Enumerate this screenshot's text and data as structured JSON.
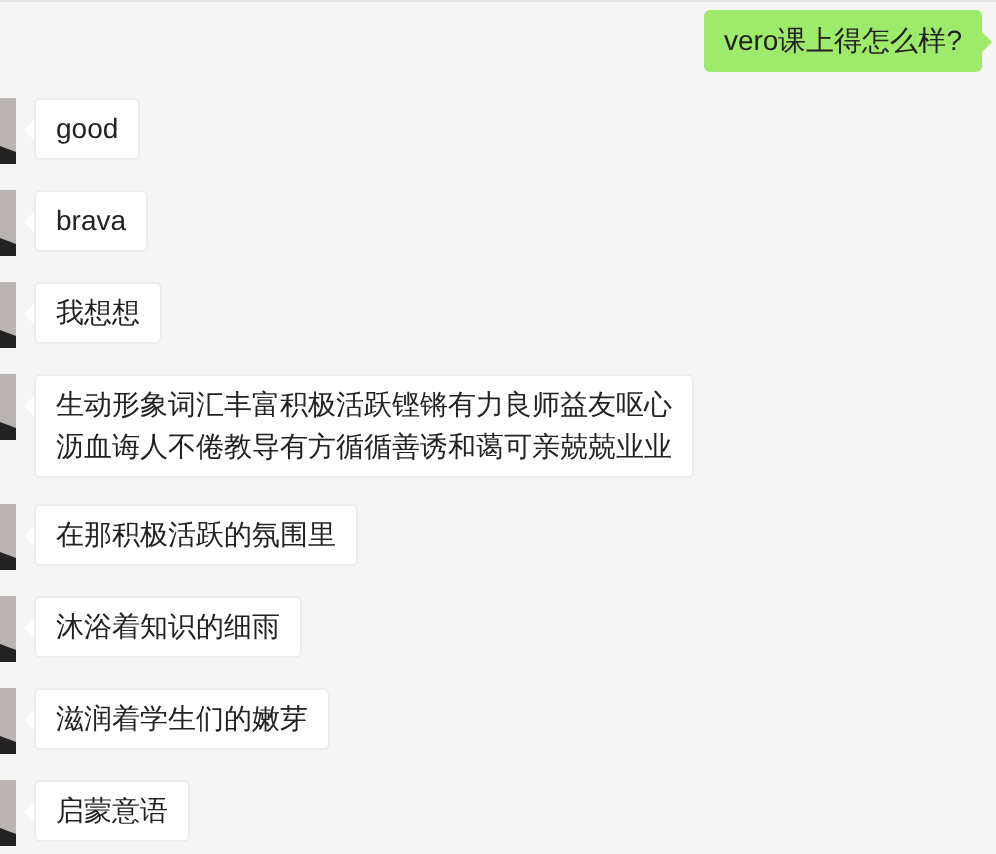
{
  "messages": [
    {
      "kind": "outgoing",
      "text": "vero课上得怎么样?"
    },
    {
      "kind": "incoming",
      "text": "good"
    },
    {
      "kind": "incoming",
      "text": "brava"
    },
    {
      "kind": "incoming",
      "text": "我想想"
    },
    {
      "kind": "incoming",
      "text": "生动形象词汇丰富积极活跃铿锵有力良师益友呕心沥血诲人不倦教导有方循循善诱和蔼可亲兢兢业业"
    },
    {
      "kind": "incoming",
      "text": "在那积极活跃的氛围里"
    },
    {
      "kind": "incoming",
      "text": "沐浴着知识的细雨"
    },
    {
      "kind": "incoming",
      "text": "滋润着学生们的嫩芽"
    },
    {
      "kind": "incoming",
      "text": "启蒙意语"
    }
  ]
}
